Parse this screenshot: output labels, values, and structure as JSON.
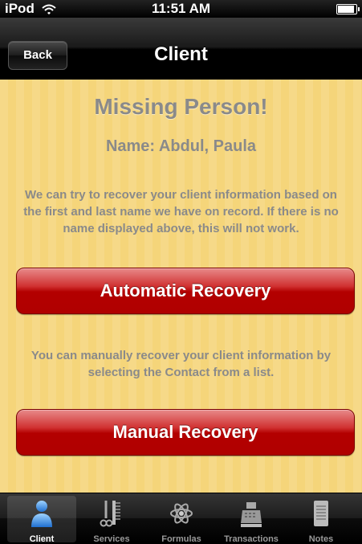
{
  "status_bar": {
    "carrier": "iPod",
    "time": "11:51 AM"
  },
  "nav": {
    "back_label": "Back",
    "title": "Client"
  },
  "main": {
    "heading": "Missing Person!",
    "name_line": "Name: Abdul, Paula",
    "auto_text": "We can try to recover your client information based on the first and last name we have on record. If there is no name displayed above, this will not work.",
    "auto_button": "Automatic Recovery",
    "manual_text": "You can manually recover your client information by selecting the Contact from a list.",
    "manual_button": "Manual Recovery"
  },
  "tabs": [
    {
      "label": "Client",
      "icon": "person-icon",
      "selected": true
    },
    {
      "label": "Services",
      "icon": "comb-scissors-icon",
      "selected": false
    },
    {
      "label": "Formulas",
      "icon": "atom-icon",
      "selected": false
    },
    {
      "label": "Transactions",
      "icon": "cash-register-icon",
      "selected": false
    },
    {
      "label": "Notes",
      "icon": "notes-icon",
      "selected": false
    }
  ],
  "colors": {
    "background": "#f5d57a",
    "button_red": "#b30000",
    "text_gray": "#8a8a8a"
  }
}
